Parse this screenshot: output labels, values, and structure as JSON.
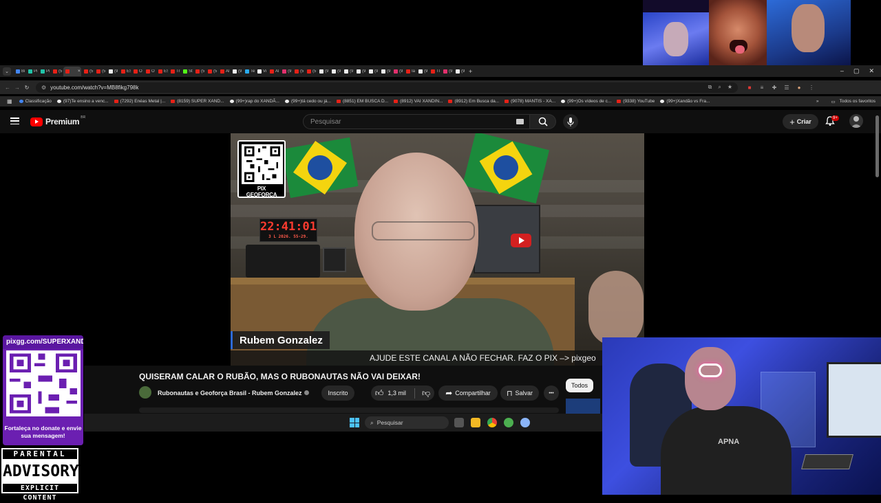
{
  "browser": {
    "tabs": [
      {
        "label": "Bi",
        "color": "#4285f4"
      },
      {
        "label": "Pi",
        "color": "#22c3a8"
      },
      {
        "label": "Pi",
        "color": "#22c3a8"
      },
      {
        "label": "(5",
        "color": "#e62117"
      },
      {
        "label": "",
        "color": "#e62117",
        "active": true
      },
      {
        "label": "(5",
        "color": "#e62117"
      },
      {
        "label": "(5",
        "color": "#e62117"
      },
      {
        "label": "(9",
        "color": "#eeeeee"
      },
      {
        "label": "ES",
        "color": "#e62117"
      },
      {
        "label": "O",
        "color": "#e62117"
      },
      {
        "label": "O",
        "color": "#e62117"
      },
      {
        "label": "ES",
        "color": "#e62117"
      },
      {
        "label": "Tr",
        "color": "#e62117"
      },
      {
        "label": "St",
        "color": "#53fc18"
      },
      {
        "label": "(5",
        "color": "#e62117"
      },
      {
        "label": "(5",
        "color": "#e62117"
      },
      {
        "label": "Al",
        "color": "#e62117"
      },
      {
        "label": "(9",
        "color": "#eeeeee"
      },
      {
        "label": "Te",
        "color": "#2aabee"
      },
      {
        "label": "Vi",
        "color": "#ffffff"
      },
      {
        "label": "Al",
        "color": "#e62117"
      },
      {
        "label": "(9",
        "color": "#e1306c"
      },
      {
        "label": "(5",
        "color": "#e62117"
      },
      {
        "label": "(5",
        "color": "#e62117"
      },
      {
        "label": "(9",
        "color": "#eeeeee"
      },
      {
        "label": "(9",
        "color": "#eeeeee"
      },
      {
        "label": "(9",
        "color": "#eeeeee"
      },
      {
        "label": "(9",
        "color": "#eeeeee"
      },
      {
        "label": "(9",
        "color": "#eeeeee"
      },
      {
        "label": "(9",
        "color": "#eeeeee"
      },
      {
        "label": "(9",
        "color": "#e1306c"
      },
      {
        "label": "Ia",
        "color": "#e62117"
      },
      {
        "label": "(9",
        "color": "#eeeeee"
      },
      {
        "label": "Tl",
        "color": "#e62117"
      },
      {
        "label": "(9",
        "color": "#e1306c"
      },
      {
        "label": "(9",
        "color": "#eeeeee"
      }
    ],
    "new_tab": "+",
    "window_controls": [
      "–",
      "▢",
      "✕"
    ],
    "url": "youtube.com/watch?v=MB8fikg798k",
    "bookmarks": [
      {
        "label": "Classificação",
        "kind": "g"
      },
      {
        "label": "(97)Te ensino a venc...",
        "kind": "tk"
      },
      {
        "label": "(7292) Enéas Metal |...",
        "kind": "yt"
      },
      {
        "label": "(8159) SUPER XAND...",
        "kind": "yt"
      },
      {
        "label": "(99+)rap do XANDÃ...",
        "kind": "tk"
      },
      {
        "label": "(99+)tá cedo ou já...",
        "kind": "tk"
      },
      {
        "label": "(8851) EM BUSCA D...",
        "kind": "yt"
      },
      {
        "label": "(8912) VAI XANDIN...",
        "kind": "yt"
      },
      {
        "label": "(8912) Em Busca da...",
        "kind": "yt"
      },
      {
        "label": "(9078) MANTIS - XA...",
        "kind": "yt"
      },
      {
        "label": "(99+)Os vídeos de c...",
        "kind": "tk"
      },
      {
        "label": "(9338) YouTube",
        "kind": "yt"
      },
      {
        "label": "(99+)Xandão vs Fra...",
        "kind": "tk"
      }
    ],
    "bookmarks_more": "»",
    "all_favorites": "Todos os favoritos"
  },
  "youtube": {
    "brand": "Premium",
    "region": "BR",
    "search_placeholder": "Pesquisar",
    "create_label": "Criar",
    "notifications": "9+",
    "video": {
      "qr_label": "PIX GEOFORÇA",
      "clock_time": "22:41:01",
      "clock_sub": "3 L  2026.  55-29.",
      "speaker_name": "Rubem Gonzalez",
      "ticker": "AJUDE ESTE CANAL A NÃO FECHAR. FAZ O PIX –> pixgeo"
    },
    "title": "QUISERAM CALAR O RUBÃO, MAS O RUBONAUTAS NÃO VAI DEIXAR!",
    "channel": "Rubonautas e Geoforça Brasil - Rubem Gonzalez",
    "subscribed": "Inscrito",
    "likes": "1,3 mil",
    "share": "Compartilhar",
    "save": "Salvar",
    "more": "•••",
    "filter_chip": "Todos"
  },
  "taskbar": {
    "search_placeholder": "Pesquisar"
  },
  "overlays": {
    "donate_url": "pixgg.com/SUPERXANDÃO",
    "donate_message": "Fortaleça no donate e envie sua mensagem!",
    "advisory": [
      "PARENTAL",
      "ADVISORY",
      "EXPLICIT CONTENT"
    ],
    "shirt_logo": "APNA"
  }
}
